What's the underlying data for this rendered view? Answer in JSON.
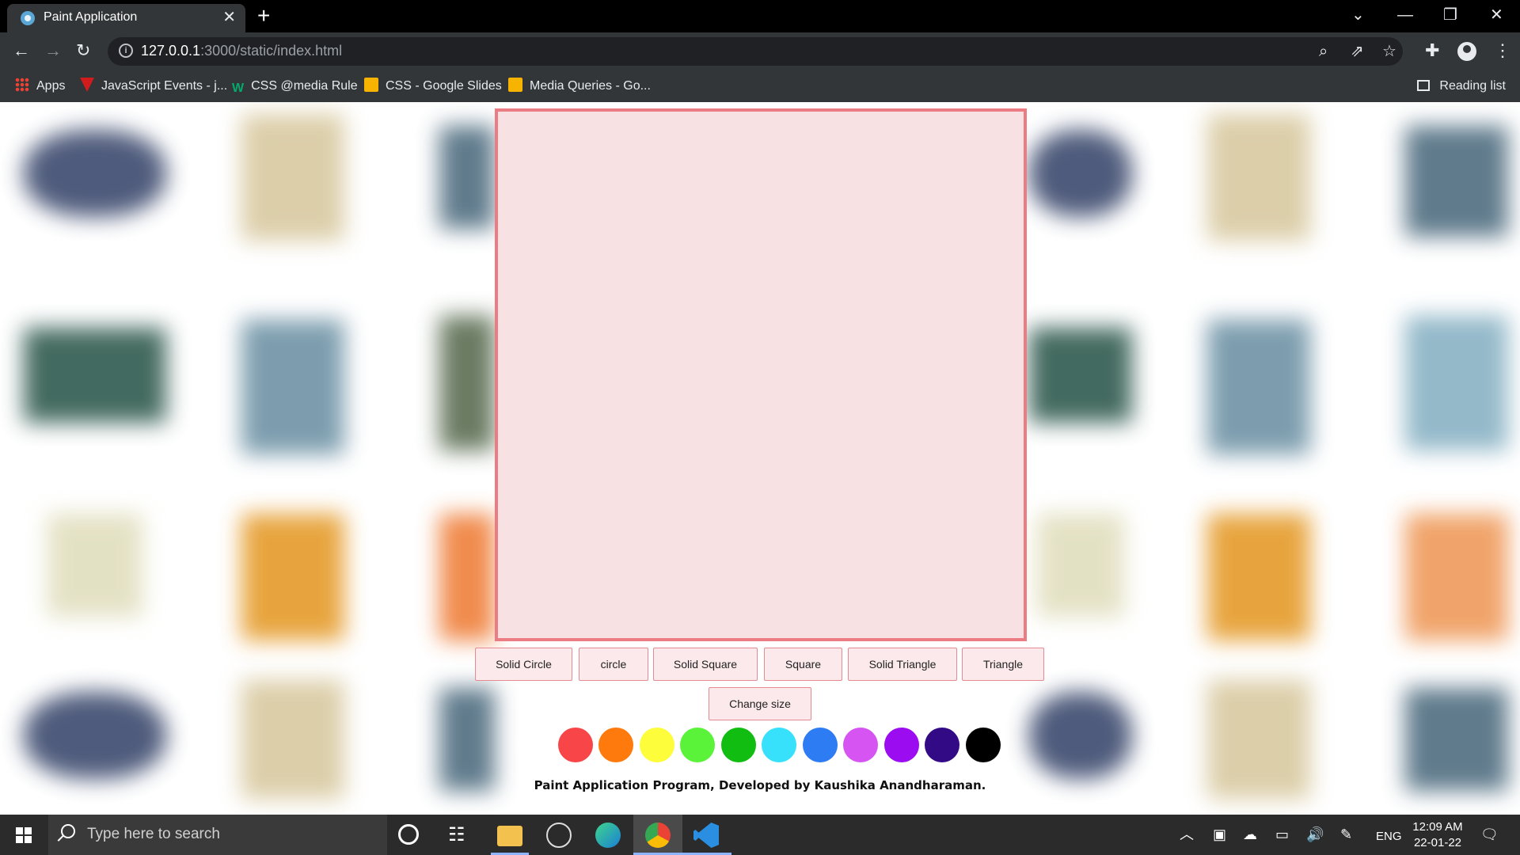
{
  "browser": {
    "tab_title": "Paint Application",
    "url_host": "127.0.0.1",
    "url_rest": ":3000/static/index.html",
    "bookmarks": [
      {
        "label": "Apps"
      },
      {
        "label": "JavaScript Events - j..."
      },
      {
        "label": "CSS @media Rule"
      },
      {
        "label": "CSS - Google Slides"
      },
      {
        "label": "Media Queries - Go..."
      }
    ],
    "reading_list": "Reading list"
  },
  "app": {
    "shape_buttons": [
      "Solid Circle",
      "circle",
      "Solid Square",
      "Square",
      "Solid Triangle",
      "Triangle"
    ],
    "change_size_label": "Change size",
    "colors": [
      "#ffffff",
      "#f84547",
      "#ff7a0c",
      "#fdfd3c",
      "#5bf33a",
      "#11bd11",
      "#37e1fb",
      "#2d7cf3",
      "#d655f2",
      "#9b0cf0",
      "#330a85",
      "#000000"
    ],
    "footer": "Paint Application Program, Developed by Kaushika Anandharaman.",
    "canvas_color": "#f8e1e3",
    "accent_color": "#ec7c84"
  },
  "taskbar": {
    "search_placeholder": "Type here to search",
    "language": "ENG",
    "time": "12:09 AM",
    "date": "22-01-22"
  }
}
